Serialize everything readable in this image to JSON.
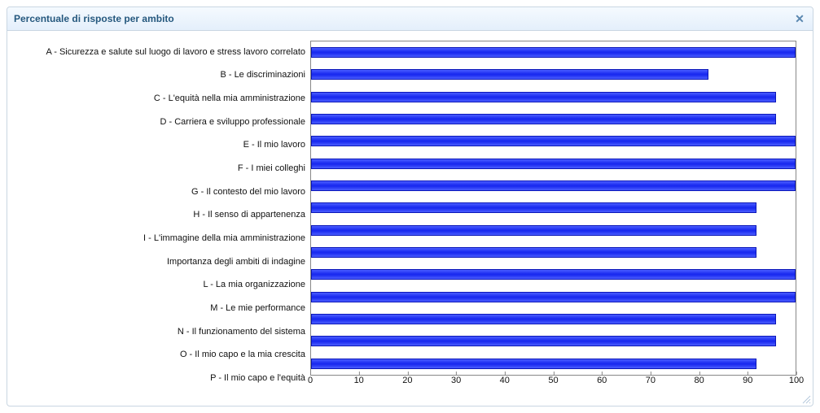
{
  "panel": {
    "title": "Percentuale di risposte per ambito",
    "close_label": "✕"
  },
  "chart_data": {
    "type": "bar",
    "orientation": "horizontal",
    "categories": [
      "A - Sicurezza e salute sul luogo di lavoro e stress lavoro correlato",
      "B - Le discriminazioni",
      "C - L'equità nella mia amministrazione",
      "D - Carriera e sviluppo professionale",
      "E - Il mio lavoro",
      "F - I miei colleghi",
      "G - Il contesto del mio lavoro",
      "H - Il senso di appartenenza",
      "I - L'immagine della mia amministrazione",
      "Importanza degli ambiti di indagine",
      "L - La mia organizzazione",
      "M - Le mie performance",
      "N - Il funzionamento del sistema",
      "O - Il mio capo e la mia crescita",
      "P - Il mio capo e l'equità"
    ],
    "values": [
      100,
      82,
      96,
      96,
      100,
      100,
      100,
      92,
      92,
      92,
      100,
      100,
      96,
      96,
      92
    ],
    "title": "Percentuale di risposte per ambito",
    "xlabel": "",
    "ylabel": "",
    "xlim": [
      0,
      100
    ],
    "xticks": [
      0,
      10,
      20,
      30,
      40,
      50,
      60,
      70,
      80,
      90,
      100
    ]
  }
}
